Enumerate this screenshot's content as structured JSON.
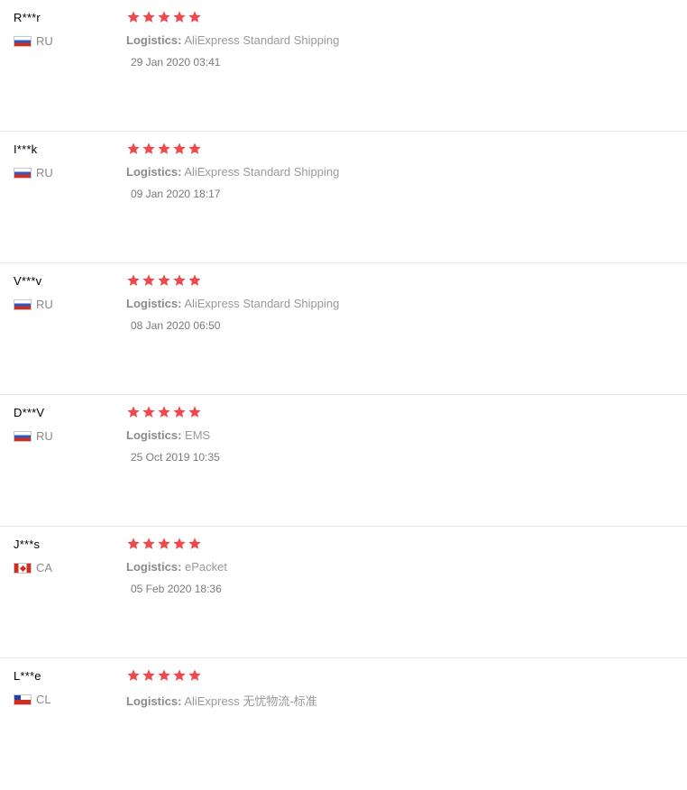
{
  "reviews": [
    {
      "user": "R***r",
      "country": "RU",
      "flag": "ru-flag-icon",
      "rating": 5,
      "logistics_label": "Logistics:",
      "logistics_value": "AliExpress Standard Shipping",
      "date": "29 Jan 2020 03:41"
    },
    {
      "user": "I***k",
      "country": "RU",
      "flag": "ru-flag-icon",
      "rating": 5,
      "logistics_label": "Logistics:",
      "logistics_value": "AliExpress Standard Shipping",
      "date": "09 Jan 2020 18:17"
    },
    {
      "user": "V***v",
      "country": "RU",
      "flag": "ru-flag-icon",
      "rating": 5,
      "logistics_label": "Logistics:",
      "logistics_value": "AliExpress Standard Shipping",
      "date": "08 Jan 2020 06:50"
    },
    {
      "user": "D***V",
      "country": "RU",
      "flag": "ru-flag-icon",
      "rating": 5,
      "logistics_label": "Logistics:",
      "logistics_value": "EMS",
      "date": "25 Oct 2019 10:35"
    },
    {
      "user": "J***s",
      "country": "CA",
      "flag": "ca-flag-icon",
      "rating": 5,
      "logistics_label": "Logistics:",
      "logistics_value": "ePacket",
      "date": "05 Feb 2020 18:36"
    },
    {
      "user": "L***e",
      "country": "CL",
      "flag": "cl-flag-icon",
      "rating": 5,
      "logistics_label": "Logistics:",
      "logistics_value": "AliExpress 无忧物流-标准",
      "date": ""
    }
  ],
  "colors": {
    "star": "#f0484c",
    "divider": "#e8e8e8",
    "meta_text": "#999999"
  }
}
